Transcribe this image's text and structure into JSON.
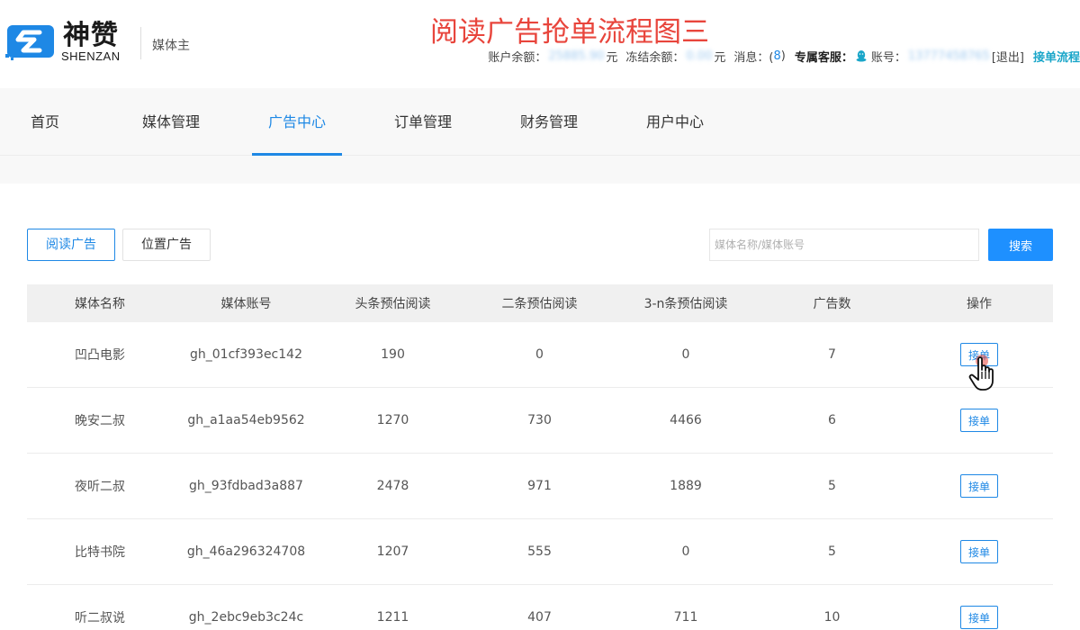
{
  "brand": {
    "name_cn": "神赞",
    "name_en": "SHENZAN",
    "role": "媒体主"
  },
  "flow_title": "阅读广告抢单流程图三",
  "account": {
    "balance_label": "账户余额：",
    "balance_value": "25885.90",
    "currency": "元",
    "frozen_label": "冻结余额：",
    "frozen_value": "0.00",
    "message_label": "消息：(",
    "message_count": "8",
    "message_close": ")",
    "service_label": "专属客服：",
    "account_label": "账号：",
    "account_value": "13777458765",
    "logout": "[退出]",
    "flow_link": "接单流程"
  },
  "nav": {
    "items": [
      "首页",
      "媒体管理",
      "广告中心",
      "订单管理",
      "财务管理",
      "用户中心"
    ],
    "active": "广告中心"
  },
  "tabs": [
    "阅读广告",
    "位置广告"
  ],
  "search": {
    "placeholder": "媒体名称/媒体账号",
    "button": "搜索"
  },
  "table": {
    "headers": [
      "媒体名称",
      "媒体账号",
      "头条预估阅读",
      "二条预估阅读",
      "3-n条预估阅读",
      "广告数",
      "操作"
    ],
    "action_label": "接单",
    "rows": [
      {
        "name": "凹凸电影",
        "account": "gh_01cf393ec142",
        "head": "190",
        "second": "0",
        "rest": "0",
        "ads": "7"
      },
      {
        "name": "晚安二叔",
        "account": "gh_a1aa54eb9562",
        "head": "1270",
        "second": "730",
        "rest": "4466",
        "ads": "6"
      },
      {
        "name": "夜听二叔",
        "account": "gh_93fdbad3a887",
        "head": "2478",
        "second": "971",
        "rest": "1889",
        "ads": "5"
      },
      {
        "name": "比特书院",
        "account": "gh_46a296324708",
        "head": "1207",
        "second": "555",
        "rest": "0",
        "ads": "5"
      },
      {
        "name": "听二叔说",
        "account": "gh_2ebc9eb3c24c",
        "head": "1211",
        "second": "407",
        "rest": "711",
        "ads": "10"
      }
    ]
  },
  "colors": {
    "primary": "#1e88e5",
    "title_red": "#e8453c",
    "flow_link": "#1aa6c9"
  }
}
